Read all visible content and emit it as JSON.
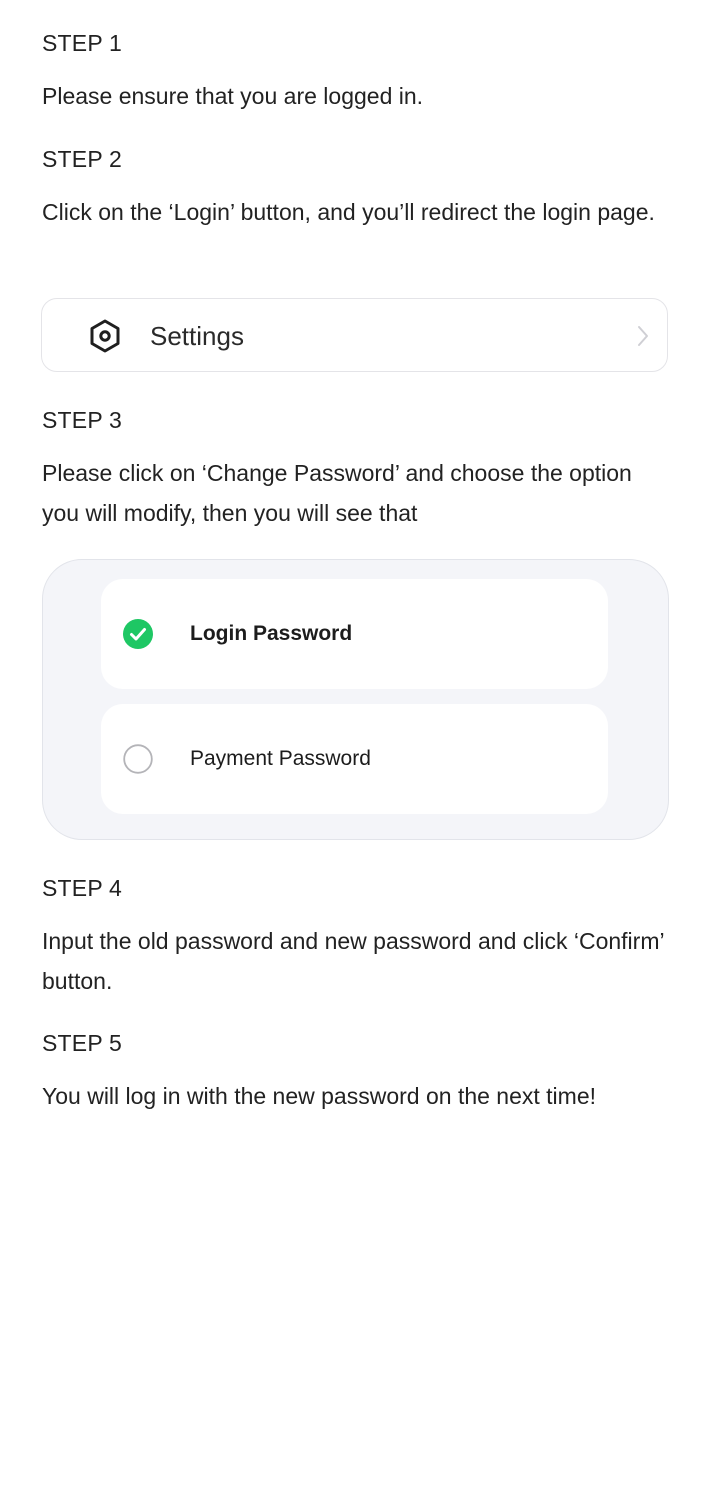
{
  "steps": [
    {
      "title": "STEP 1",
      "text": "Please ensure that you are logged in."
    },
    {
      "title": "STEP 2",
      "text": "Click on the ‘Login’ button, and you’ll redirect the login page."
    },
    {
      "title": "STEP 3",
      "text": "Please click on ‘Change Password’ and choose the option you will modify, then you will see that"
    },
    {
      "title": "STEP 4",
      "text": "Input the old password and new password and click ‘Confirm’ button."
    },
    {
      "title": "STEP 5",
      "text": "You will log in with the new password on the next time!"
    }
  ],
  "settings": {
    "label": "Settings",
    "icon": "settings-hex-icon",
    "chevron_icon": "chevron-right-icon"
  },
  "password_options": [
    {
      "label": "Login Password",
      "selected": true
    },
    {
      "label": "Payment Password",
      "selected": false
    }
  ],
  "colors": {
    "check_green": "#1ec764",
    "panel_bg": "#f4f5f9",
    "text": "#222222"
  }
}
